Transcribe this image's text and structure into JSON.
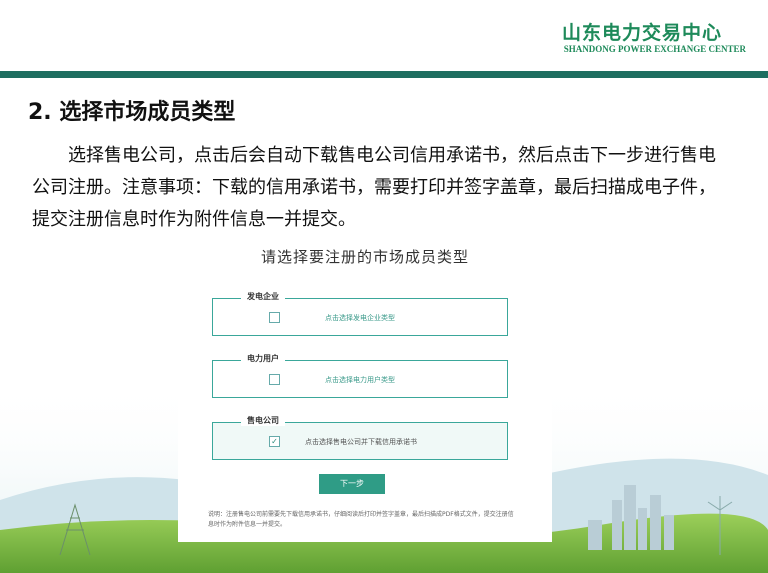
{
  "header": {
    "logo_cn": "山东电力交易中心",
    "logo_en": "SHANDONG POWER EXCHANGE CENTER"
  },
  "section": {
    "title": "2. 选择市场成员类型",
    "paragraph": "选择售电公司，点击后会自动下载售电公司信用承诺书，然后点击下一步进行售电公司注册。注意事项：下载的信用承诺书，需要打印并签字盖章，最后扫描成电子件，提交注册信息时作为附件信息一并提交。"
  },
  "panel": {
    "title": "请选择要注册的市场成员类型",
    "options": [
      {
        "legend": "发电企业",
        "text": "点击选择发电企业类型",
        "checked": false
      },
      {
        "legend": "电力用户",
        "text": "点击选择电力用户类型",
        "checked": false
      },
      {
        "legend": "售电公司",
        "text": "点击选择售电公司并下载信用承诺书",
        "checked": true
      }
    ],
    "next_label": "下一步",
    "note": "说明：注册售电公司前需要先下载信用承诺书，仔细阅读后打印并签字盖章，最后扫描成PDF格式文件，提交注册信息时作为附件信息一并提交。"
  },
  "colors": {
    "accent": "#1e6e60",
    "brand": "#1e8a5a",
    "button": "#2f9c86"
  }
}
